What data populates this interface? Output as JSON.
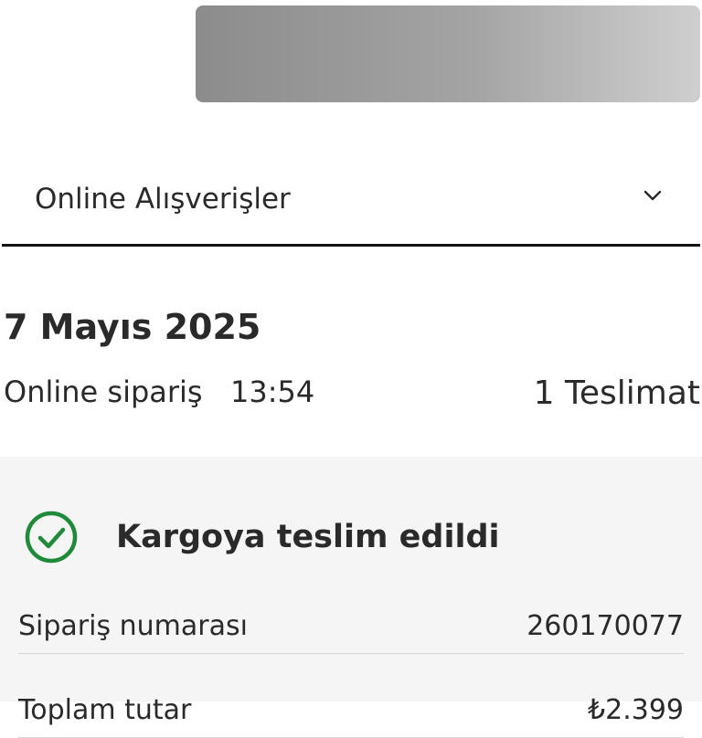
{
  "header": {
    "redacted_banner": ""
  },
  "dropdown": {
    "label": "Online Alışverişler",
    "icon": "chevron-down-icon"
  },
  "order": {
    "date": "7 Mayıs 2025",
    "type": "Online sipariş",
    "time": "13:54",
    "deliveries": "1 Teslimat"
  },
  "status": {
    "icon": "check-circle-icon",
    "text": "Kargoya teslim edildi",
    "color": "#1f8a3a"
  },
  "details": [
    {
      "label": "Sipariş numarası",
      "value": "260170077"
    },
    {
      "label": "Toplam tutar",
      "value": "₺2.399"
    }
  ]
}
